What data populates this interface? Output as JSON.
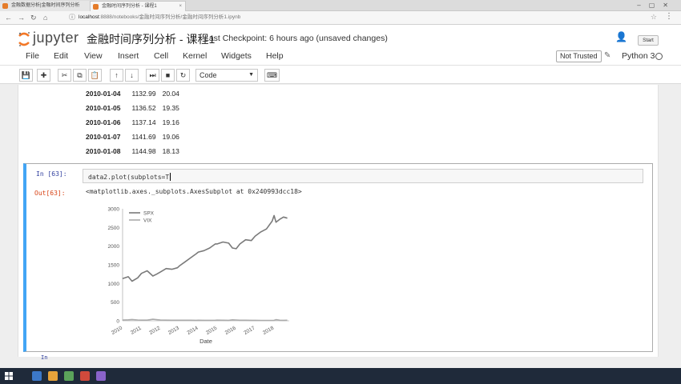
{
  "browser": {
    "tabs": [
      {
        "label": "金融数据分析|金融时间序列分析"
      },
      {
        "label": "金融时间序列分析 - 课程1"
      }
    ],
    "url_host": "localhost",
    "url_rest": ":8888/notebooks/金融时间序列分析/金融时间序列分析1.ipynb"
  },
  "jupyter": {
    "logo": "jupyter",
    "notebook_title": "金融时间序列分析 - 课程1",
    "checkpoint": "Last Checkpoint: 6 hours ago (unsaved changes)",
    "logout_label": "Start"
  },
  "menu": {
    "items": [
      "File",
      "Edit",
      "View",
      "Insert",
      "Cell",
      "Kernel",
      "Widgets",
      "Help"
    ],
    "trust": "Not Trusted",
    "kernel": "Python 3"
  },
  "toolbar": {
    "cell_type": "Code",
    "buttons": [
      "save-icon",
      "plus-icon",
      "cut-icon",
      "copy-icon",
      "paste-icon",
      "up-icon",
      "down-icon",
      "run-icon",
      "stop-icon",
      "restart-icon",
      "keyboard-icon"
    ]
  },
  "table": {
    "rows": [
      {
        "date": "2010-01-04",
        "spx": "1132.99",
        "vix": "20.04"
      },
      {
        "date": "2010-01-05",
        "spx": "1136.52",
        "vix": "19.35"
      },
      {
        "date": "2010-01-06",
        "spx": "1137.14",
        "vix": "19.16"
      },
      {
        "date": "2010-01-07",
        "spx": "1141.69",
        "vix": "19.06"
      },
      {
        "date": "2010-01-08",
        "spx": "1144.98",
        "vix": "18.13"
      }
    ]
  },
  "cell": {
    "in_prompt": "In [63]:",
    "code": "data2.plot(subplots=T",
    "out_prompt": "Out[63]:",
    "output": "<matplotlib.axes._subplots.AxesSubplot at 0x240993dcc18>",
    "next_prompt": "In"
  },
  "chart_data": {
    "type": "line",
    "title": "",
    "xlabel": "Date",
    "ylabel": "",
    "ylim": [
      0,
      3000
    ],
    "yticks": [
      0,
      500,
      1000,
      1500,
      2000,
      2500,
      3000
    ],
    "xticks": [
      "2010",
      "2011",
      "2012",
      "2013",
      "2014",
      "2015",
      "2016",
      "2017",
      "2018"
    ],
    "legend_position": "top-left",
    "x": [
      2010.0,
      2010.3,
      2010.5,
      2010.8,
      2011.0,
      2011.3,
      2011.6,
      2011.8,
      2012.0,
      2012.3,
      2012.6,
      2012.9,
      2013.0,
      2013.3,
      2013.6,
      2013.9,
      2014.0,
      2014.3,
      2014.6,
      2014.9,
      2015.0,
      2015.3,
      2015.6,
      2015.8,
      2016.0,
      2016.2,
      2016.5,
      2016.8,
      2017.0,
      2017.3,
      2017.6,
      2017.9,
      2018.0,
      2018.1,
      2018.3,
      2018.5,
      2018.7
    ],
    "series": [
      {
        "name": "SPX",
        "color": "#7a7a7a",
        "values": [
          1130,
          1180,
          1060,
          1150,
          1270,
          1340,
          1200,
          1250,
          1310,
          1400,
          1380,
          1420,
          1470,
          1580,
          1690,
          1800,
          1840,
          1880,
          1950,
          2060,
          2060,
          2110,
          2080,
          1950,
          1930,
          2060,
          2170,
          2150,
          2270,
          2380,
          2460,
          2670,
          2820,
          2640,
          2720,
          2780,
          2750
        ]
      },
      {
        "name": "VIX",
        "color": "#aaaaaa",
        "values": [
          20,
          25,
          35,
          22,
          18,
          17,
          40,
          30,
          20,
          17,
          16,
          15,
          14,
          15,
          14,
          13,
          14,
          12,
          13,
          15,
          17,
          14,
          13,
          25,
          22,
          16,
          14,
          13,
          12,
          11,
          10,
          11,
          12,
          30,
          16,
          13,
          14
        ]
      }
    ]
  }
}
